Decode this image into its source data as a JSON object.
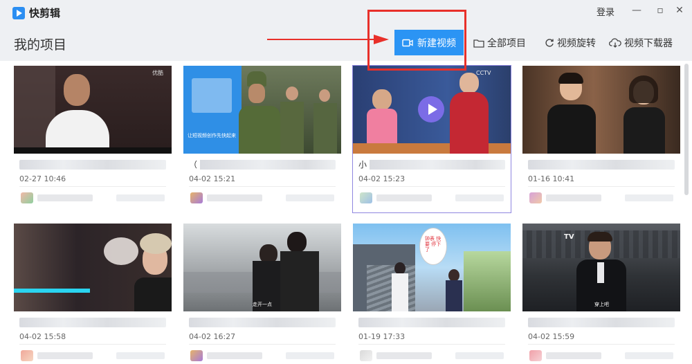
{
  "app": {
    "name": "快剪辑",
    "login": "登录",
    "minimize": "—",
    "maximize": "▫",
    "close": "✕"
  },
  "page_title": "我的项目",
  "toolbar": {
    "new_video": "新建视频",
    "all_projects": "全部项目",
    "rotate_video": "视频旋转",
    "video_download": "视频下载器"
  },
  "icons": {
    "camera": "camera-icon",
    "folder": "folder-icon",
    "rotate": "rotate-icon",
    "cloud": "cloud-download-icon"
  },
  "colors": {
    "accent": "#2b94f4",
    "annotation": "#e8302a",
    "selected_outline": "#8f86e0",
    "play": "#7b6ce6"
  },
  "cards": [
    {
      "name": "",
      "date": "02-27 10:46",
      "thumb_badge": "优酷"
    },
    {
      "name": "（",
      "date": "04-02 15:21",
      "thumb_caption": "让短视频创作先快起来"
    },
    {
      "name": "小",
      "date": "04-02 15:23",
      "thumb_badge": "CCTV"
    },
    {
      "name": "",
      "date": "01-16 10:41"
    },
    {
      "name": "",
      "date": "04-02 15:58"
    },
    {
      "name": "",
      "date": "04-02 16:27",
      "thumb_caption": "走开一点"
    },
    {
      "name": "",
      "date": "01-19 17:33",
      "thumb_caption": "钟表 快要 停下 了"
    },
    {
      "name": "",
      "date": "04-02 15:59",
      "thumb_badge": "TV",
      "thumb_caption": "穿上吧"
    }
  ]
}
